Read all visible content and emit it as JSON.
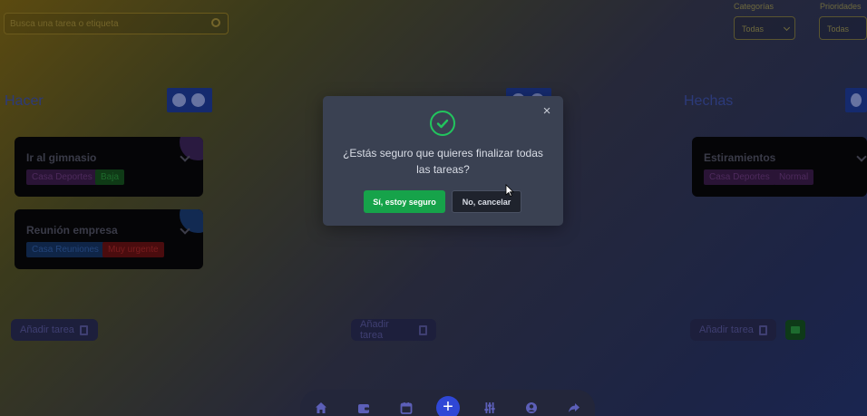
{
  "app": {
    "search": {
      "placeholder": "Busca una tarea o etiqueta"
    },
    "filters": [
      {
        "label": "Categorías",
        "value": "Todas"
      },
      {
        "label": "Prioridades",
        "value": "Todas"
      }
    ],
    "columns": [
      {
        "title": "Hacer",
        "cards": [
          {
            "title": "Ir al gimnasio",
            "tags": [
              "Casa Deportes",
              "Baja"
            ]
          },
          {
            "title": "Reunión empresa",
            "tags": [
              "Casa Reuniones",
              "Muy urgente"
            ]
          }
        ],
        "add_label": "Añadir tarea"
      },
      {
        "title": "",
        "cards": [],
        "add_label": "Añadir tarea"
      },
      {
        "title": "Hechas",
        "cards": [
          {
            "title": "Estiramientos",
            "tags": [
              "Casa Deportes",
              "Normal"
            ]
          }
        ],
        "add_label": "Añadir tarea"
      }
    ],
    "bottom_nav": [
      "home-icon",
      "wallet-icon",
      "calendar-icon",
      "plus-icon",
      "sliders-icon",
      "user-circle-icon",
      "share-icon"
    ]
  },
  "modal": {
    "message": "¿Estás seguro que quieres finalizar todas las tareas?",
    "confirm_label": "Sí, estoy seguro",
    "cancel_label": "No, cancelar",
    "close_symbol": "×",
    "icon": "check-circle-icon",
    "accent_color": "#22c55e"
  }
}
